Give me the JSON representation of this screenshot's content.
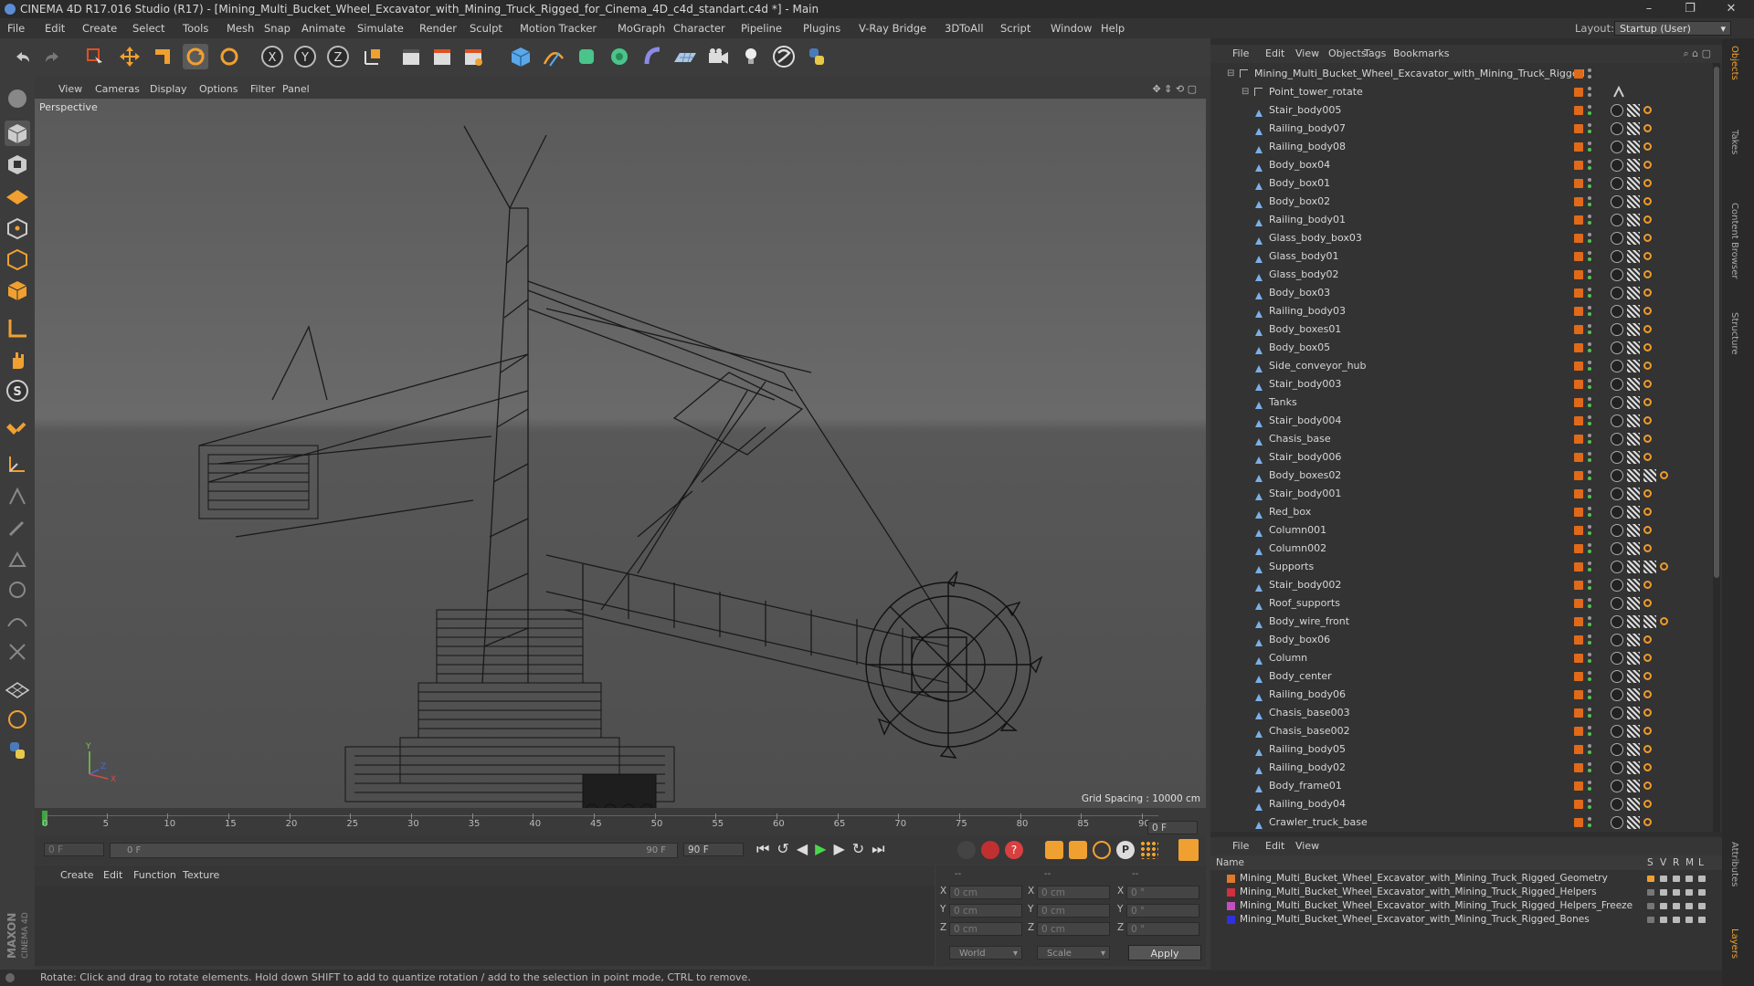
{
  "window": {
    "title": "CINEMA 4D R17.016 Studio (R17) - [Mining_Multi_Bucket_Wheel_Excavator_with_Mining_Truck_Rigged_for_Cinema_4D_c4d_standart.c4d *] - Main",
    "minimize": "–",
    "maximize": "❐",
    "close": "✕"
  },
  "menubar": {
    "items": [
      "File",
      "Edit",
      "Create",
      "Select",
      "Tools",
      "Mesh",
      "Snap",
      "Animate",
      "Simulate",
      "Render",
      "Sculpt",
      "Motion Tracker",
      "MoGraph",
      "Character",
      "Pipeline",
      "Plugins",
      "V-Ray Bridge",
      "3DToAll",
      "Script",
      "Window",
      "Help"
    ],
    "layout_label": "Layout:",
    "layout_value": "Startup (User)"
  },
  "viewport": {
    "menu": [
      "View",
      "Cameras",
      "Display",
      "Options",
      "Filter",
      "Panel"
    ],
    "label": "Perspective",
    "grid_spacing": "Grid Spacing : 10000 cm",
    "axis_y": "Y",
    "axis_x": "X",
    "axis_z": "Z"
  },
  "timeline": {
    "ticks": [
      "0",
      "5",
      "10",
      "15",
      "20",
      "25",
      "30",
      "35",
      "40",
      "45",
      "50",
      "55",
      "60",
      "65",
      "70",
      "75",
      "80",
      "85",
      "90"
    ],
    "end_frame": "0 F"
  },
  "playbar": {
    "current_frame": "0 F",
    "range_start": "0 F",
    "range_end": "90 F",
    "max_frame": "90 F"
  },
  "material_manager": {
    "menu": [
      "Create",
      "Edit",
      "Function",
      "Texture"
    ]
  },
  "coordinates": {
    "header": [
      "--",
      "--",
      "--"
    ],
    "rows": [
      {
        "axis": "X",
        "pos": "0 cm",
        "axis2": "X",
        "size": "0 cm",
        "axis3": "X",
        "rot": "0 °"
      },
      {
        "axis": "Y",
        "pos": "0 cm",
        "axis2": "Y",
        "size": "0 cm",
        "axis3": "Y",
        "rot": "0 °"
      },
      {
        "axis": "Z",
        "pos": "0 cm",
        "axis2": "Z",
        "size": "0 cm",
        "axis3": "Z",
        "rot": "0 °"
      }
    ],
    "mode": "World",
    "scale": "Scale",
    "apply": "Apply"
  },
  "status": {
    "text": "Rotate: Click and drag to rotate elements. Hold down SHIFT to add to quantize rotation / add to the selection in point mode, CTRL to remove."
  },
  "objects_panel": {
    "menu": [
      "File",
      "Edit",
      "View",
      "Objects",
      "Tags",
      "Bookmarks"
    ],
    "root": "Mining_Multi_Bucket_Wheel_Excavator_with_Mining_Truck_Rigged",
    "group": "Point_tower_rotate",
    "items": [
      {
        "name": "Stair_body005",
        "extra": false
      },
      {
        "name": "Railing_body07",
        "extra": false
      },
      {
        "name": "Railing_body08",
        "extra": false
      },
      {
        "name": "Body_box04",
        "extra": false
      },
      {
        "name": "Body_box01",
        "extra": false
      },
      {
        "name": "Body_box02",
        "extra": false
      },
      {
        "name": "Railing_body01",
        "extra": false
      },
      {
        "name": "Glass_body_box03",
        "extra": false
      },
      {
        "name": "Glass_body01",
        "extra": false
      },
      {
        "name": "Glass_body02",
        "extra": false
      },
      {
        "name": "Body_box03",
        "extra": false
      },
      {
        "name": "Railing_body03",
        "extra": false
      },
      {
        "name": "Body_boxes01",
        "extra": false
      },
      {
        "name": "Body_box05",
        "extra": false
      },
      {
        "name": "Side_conveyor_hub",
        "extra": false
      },
      {
        "name": "Stair_body003",
        "extra": false
      },
      {
        "name": "Tanks",
        "extra": false
      },
      {
        "name": "Stair_body004",
        "extra": false
      },
      {
        "name": "Chasis_base",
        "extra": false
      },
      {
        "name": "Stair_body006",
        "extra": false
      },
      {
        "name": "Body_boxes02",
        "extra": true
      },
      {
        "name": "Stair_body001",
        "extra": false
      },
      {
        "name": "Red_box",
        "extra": false
      },
      {
        "name": "Column001",
        "extra": false
      },
      {
        "name": "Column002",
        "extra": false
      },
      {
        "name": "Supports",
        "extra": true
      },
      {
        "name": "Stair_body002",
        "extra": false
      },
      {
        "name": "Roof_supports",
        "extra": false
      },
      {
        "name": "Body_wire_front",
        "extra": true
      },
      {
        "name": "Body_box06",
        "extra": false
      },
      {
        "name": "Column",
        "extra": false
      },
      {
        "name": "Body_center",
        "extra": false
      },
      {
        "name": "Railing_body06",
        "extra": false
      },
      {
        "name": "Chasis_base003",
        "extra": false
      },
      {
        "name": "Chasis_base002",
        "extra": false
      },
      {
        "name": "Railing_body05",
        "extra": false
      },
      {
        "name": "Railing_body02",
        "extra": false
      },
      {
        "name": "Body_frame01",
        "extra": false
      },
      {
        "name": "Railing_body04",
        "extra": false
      },
      {
        "name": "Crawler_truck_base",
        "extra": false
      }
    ]
  },
  "layers_panel": {
    "menu": [
      "File",
      "Edit",
      "View"
    ],
    "col_name": "Name",
    "cols": [
      "S",
      "V",
      "R",
      "M",
      "L"
    ],
    "layers": [
      {
        "name": "Mining_Multi_Bucket_Wheel_Excavator_with_Mining_Truck_Rigged_Geometry",
        "color": "#e07a2a"
      },
      {
        "name": "Mining_Multi_Bucket_Wheel_Excavator_with_Mining_Truck_Rigged_Helpers",
        "color": "#d03040"
      },
      {
        "name": "Mining_Multi_Bucket_Wheel_Excavator_with_Mining_Truck_Rigged_Helpers_Freeze",
        "color": "#c050c0"
      },
      {
        "name": "Mining_Multi_Bucket_Wheel_Excavator_with_Mining_Truck_Rigged_Bones",
        "color": "#3030e0"
      }
    ]
  },
  "side_tabs": [
    "Objects",
    "Takes",
    "Content Browser",
    "Structure"
  ],
  "side_tabs_bottom": [
    "Attributes",
    "Layers"
  ]
}
